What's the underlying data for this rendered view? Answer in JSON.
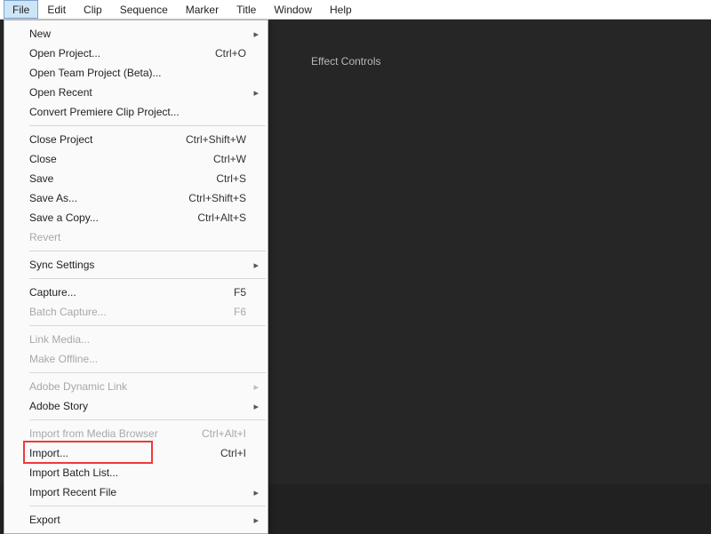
{
  "menubar": [
    "File",
    "Edit",
    "Clip",
    "Sequence",
    "Marker",
    "Title",
    "Window",
    "Help"
  ],
  "menubar_open_index": 0,
  "panel_tab": "Effect Controls",
  "menu": [
    {
      "type": "item",
      "label": "New",
      "submenu": true
    },
    {
      "type": "item",
      "label": "Open Project...",
      "shortcut": "Ctrl+O"
    },
    {
      "type": "item",
      "label": "Open Team Project (Beta)..."
    },
    {
      "type": "item",
      "label": "Open Recent",
      "submenu": true
    },
    {
      "type": "item",
      "label": "Convert Premiere Clip Project..."
    },
    {
      "type": "sep"
    },
    {
      "type": "item",
      "label": "Close Project",
      "shortcut": "Ctrl+Shift+W"
    },
    {
      "type": "item",
      "label": "Close",
      "shortcut": "Ctrl+W"
    },
    {
      "type": "item",
      "label": "Save",
      "shortcut": "Ctrl+S"
    },
    {
      "type": "item",
      "label": "Save As...",
      "shortcut": "Ctrl+Shift+S"
    },
    {
      "type": "item",
      "label": "Save a Copy...",
      "shortcut": "Ctrl+Alt+S"
    },
    {
      "type": "item",
      "label": "Revert",
      "disabled": true
    },
    {
      "type": "sep"
    },
    {
      "type": "item",
      "label": "Sync Settings",
      "submenu": true
    },
    {
      "type": "sep"
    },
    {
      "type": "item",
      "label": "Capture...",
      "shortcut": "F5"
    },
    {
      "type": "item",
      "label": "Batch Capture...",
      "shortcut": "F6",
      "disabled": true
    },
    {
      "type": "sep"
    },
    {
      "type": "item",
      "label": "Link Media...",
      "disabled": true
    },
    {
      "type": "item",
      "label": "Make Offline...",
      "disabled": true
    },
    {
      "type": "sep"
    },
    {
      "type": "item",
      "label": "Adobe Dynamic Link",
      "submenu": true,
      "disabled": true
    },
    {
      "type": "item",
      "label": "Adobe Story",
      "submenu": true
    },
    {
      "type": "sep"
    },
    {
      "type": "item",
      "label": "Import from Media Browser",
      "shortcut": "Ctrl+Alt+I",
      "disabled": true
    },
    {
      "type": "item",
      "label": "Import...",
      "shortcut": "Ctrl+I",
      "highlight": true
    },
    {
      "type": "item",
      "label": "Import Batch List..."
    },
    {
      "type": "item",
      "label": "Import Recent File",
      "submenu": true
    },
    {
      "type": "sep"
    },
    {
      "type": "item",
      "label": "Export",
      "submenu": true
    }
  ]
}
